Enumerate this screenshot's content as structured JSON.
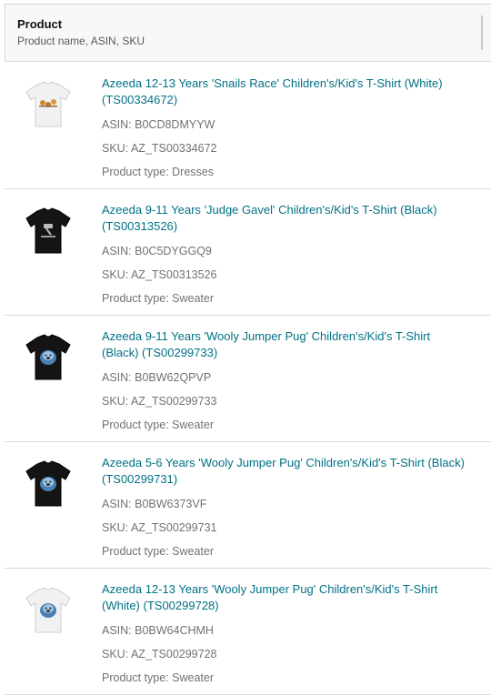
{
  "header": {
    "title": "Product",
    "subtitle": "Product name, ASIN, SKU"
  },
  "asin_prefix": "ASIN: ",
  "sku_prefix": "SKU: ",
  "type_prefix": "Product type: ",
  "colors": {
    "link": "#007185",
    "meta": "#6f7373",
    "border": "#d5d9d9"
  },
  "products": [
    {
      "name": "Azeeda 12-13 Years 'Snails Race' Children's/Kid's T-Shirt (White) (TS00334672)",
      "asin": "B0CD8DMYYW",
      "sku": "AZ_TS00334672",
      "type": "Dresses",
      "shirt_color": "white",
      "print": "snails-race"
    },
    {
      "name": "Azeeda 9-11 Years 'Judge Gavel' Children's/Kid's T-Shirt (Black) (TS00313526)",
      "asin": "B0C5DYGGQ9",
      "sku": "AZ_TS00313526",
      "type": "Sweater",
      "shirt_color": "black",
      "print": "judge-gavel"
    },
    {
      "name": "Azeeda 9-11 Years 'Wooly Jumper Pug' Children's/Kid's T-Shirt (Black) (TS00299733)",
      "asin": "B0BW62QPVP",
      "sku": "AZ_TS00299733",
      "type": "Sweater",
      "shirt_color": "black",
      "print": "wooly-jumper-pug"
    },
    {
      "name": "Azeeda 5-6 Years 'Wooly Jumper Pug' Children's/Kid's T-Shirt (Black) (TS00299731)",
      "asin": "B0BW6373VF",
      "sku": "AZ_TS00299731",
      "type": "Sweater",
      "shirt_color": "black",
      "print": "wooly-jumper-pug"
    },
    {
      "name": "Azeeda 12-13 Years 'Wooly Jumper Pug' Children's/Kid's T-Shirt (White) (TS00299728)",
      "asin": "B0BW64CHMH",
      "sku": "AZ_TS00299728",
      "type": "Sweater",
      "shirt_color": "white",
      "print": "wooly-jumper-pug"
    }
  ]
}
